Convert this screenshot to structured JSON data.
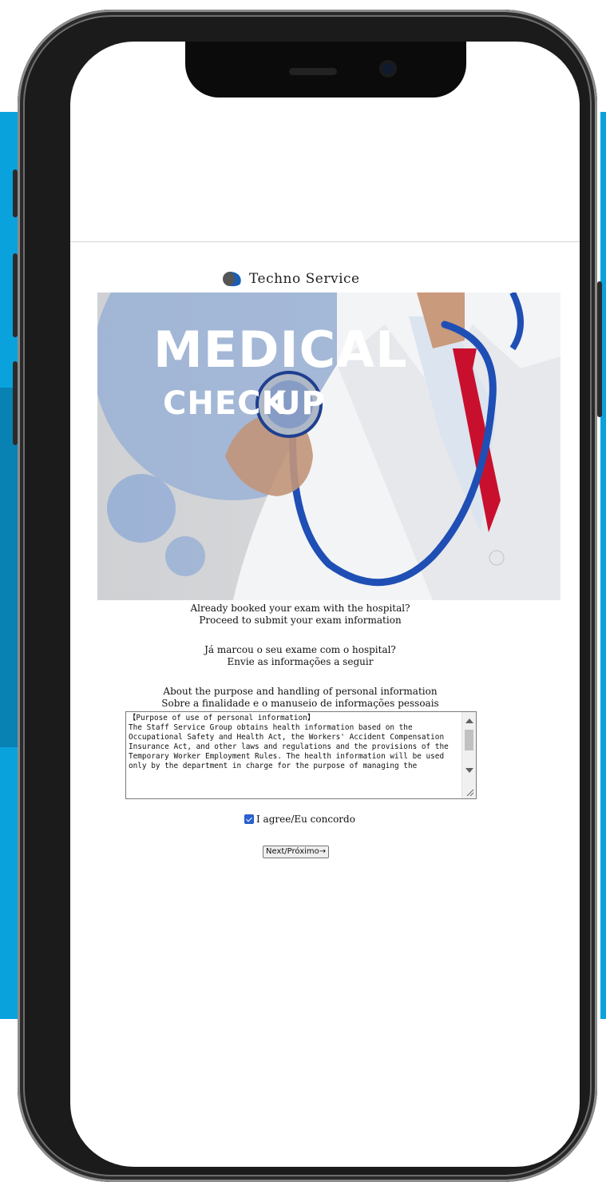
{
  "brand": {
    "name": "Techno Service"
  },
  "hero": {
    "line1": "MEDICAL",
    "line2": "CHECK",
    "line2b": "UP"
  },
  "intro": {
    "en_line1": "Already booked your exam with the hospital?",
    "en_line2": "Proceed to submit your exam information",
    "pt_line1": "Já marcou o seu exame com o hospital?",
    "pt_line2": "Envie as informações a seguir"
  },
  "privacy": {
    "heading_en": "About the purpose and handling of personal information",
    "heading_pt": "Sobre a finalidade e o manuseio de informações pessoais",
    "notice_text": "【Purpose of use of personal information】\nThe Staff Service Group obtains health information based on the Occupational Safety and Health Act, the Workers' Accident Compensation Insurance Act, and other laws and regulations and the provisions of the Temporary Worker Employment Rules. The health information will be used only by the department in charge for the purpose of managing the"
  },
  "agree": {
    "label": "I agree/Eu concordo",
    "checked": true
  },
  "next": {
    "label": "Next/Próximo→"
  },
  "colors": {
    "accent": "#0aa2dd",
    "accent_dark": "#0882b3",
    "phone": "#1b1b1b",
    "tie": "#c8102e",
    "stethoscope": "#1f4fb5"
  }
}
